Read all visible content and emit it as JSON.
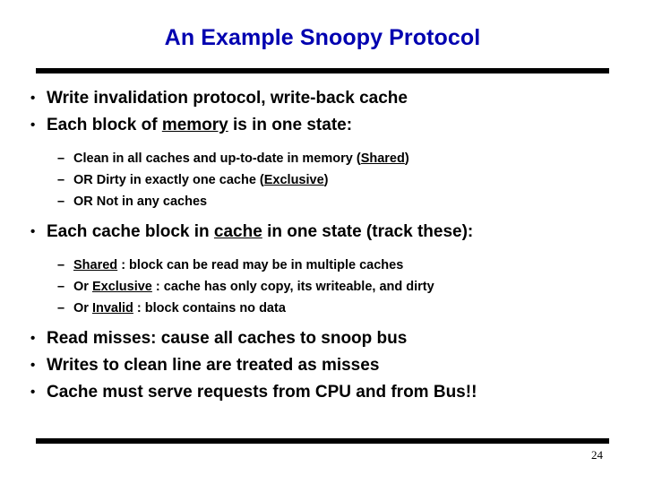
{
  "slide": {
    "title": "An Example Snoopy Protocol",
    "title_color": "#0000b0",
    "background_color": "#ffffff",
    "rule_color": "#000000",
    "page_number": "24",
    "bullet_marker": "•",
    "dash_marker": "–",
    "bullets": [
      {
        "level": 1,
        "parts": [
          {
            "text": "Write invalidation protocol, write-back cache",
            "underline": false
          }
        ]
      },
      {
        "level": 1,
        "parts": [
          {
            "text": "Each block of ",
            "underline": false
          },
          {
            "text": "memory",
            "underline": true
          },
          {
            "text": " is in one state:",
            "underline": false
          }
        ]
      },
      {
        "level": 2,
        "parts": [
          {
            "text": "Clean in all caches and up-to-date in memory (",
            "underline": false
          },
          {
            "text": "Shared",
            "underline": true
          },
          {
            "text": ")",
            "underline": false
          }
        ]
      },
      {
        "level": 2,
        "parts": [
          {
            "text": "OR Dirty in exactly one cache (",
            "underline": false
          },
          {
            "text": "Exclusive",
            "underline": true
          },
          {
            "text": ")",
            "underline": false
          }
        ]
      },
      {
        "level": 2,
        "parts": [
          {
            "text": "OR Not in any caches",
            "underline": false
          }
        ]
      },
      {
        "level": 1,
        "parts": [
          {
            "text": "Each cache block in ",
            "underline": false
          },
          {
            "text": "cache",
            "underline": true
          },
          {
            "text": " in one state (track these):",
            "underline": false
          }
        ]
      },
      {
        "level": 2,
        "parts": [
          {
            "text": "Shared",
            "underline": true
          },
          {
            "text": " : block can be read may be in multiple caches",
            "underline": false
          }
        ]
      },
      {
        "level": 2,
        "parts": [
          {
            "text": "Or ",
            "underline": false
          },
          {
            "text": "Exclusive",
            "underline": true
          },
          {
            "text": " : cache has only copy, its writeable, and dirty",
            "underline": false
          }
        ]
      },
      {
        "level": 2,
        "parts": [
          {
            "text": "Or ",
            "underline": false
          },
          {
            "text": "Invalid",
            "underline": true
          },
          {
            "text": " : block contains no data",
            "underline": false
          }
        ]
      },
      {
        "level": 1,
        "parts": [
          {
            "text": "Read misses: cause all caches to snoop bus",
            "underline": false
          }
        ]
      },
      {
        "level": 1,
        "parts": [
          {
            "text": "Writes to clean line are treated as misses",
            "underline": false
          }
        ]
      },
      {
        "level": 1,
        "parts": [
          {
            "text": "Cache must serve requests from CPU and from Bus!!",
            "underline": false
          }
        ]
      }
    ]
  }
}
